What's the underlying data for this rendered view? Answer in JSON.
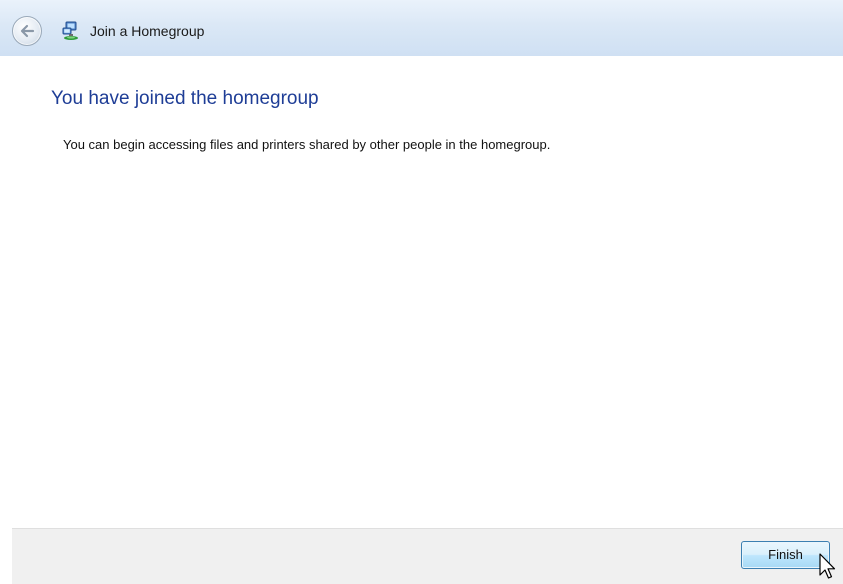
{
  "window": {
    "title": "Join a Homegroup"
  },
  "content": {
    "heading": "You have joined the homegroup",
    "message": "You can begin accessing files and printers shared by other people in the homegroup."
  },
  "footer": {
    "finish_label": "Finish"
  },
  "icons": {
    "back": "back-arrow-icon",
    "app": "homegroup-icon",
    "cursor": "mouse-pointer-icon"
  },
  "colors": {
    "heading": "#1e3d96",
    "titlebar": "#dbe8f6",
    "footer": "#f0f0f0",
    "button_border": "#3c7fb1"
  }
}
